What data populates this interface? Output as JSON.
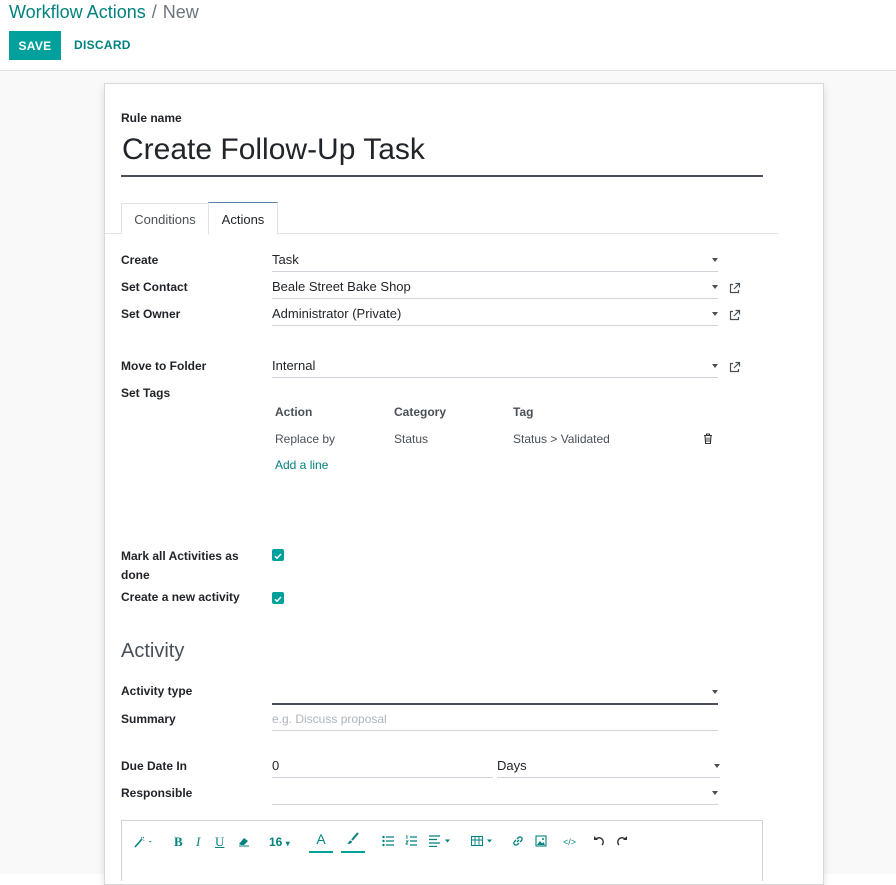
{
  "breadcrumb": {
    "parent": "Workflow Actions",
    "separator": "/",
    "current": "New"
  },
  "buttons": {
    "save": "SAVE",
    "discard": "DISCARD"
  },
  "form": {
    "rule_name_label": "Rule name",
    "rule_name": "Create Follow-Up Task",
    "tabs": [
      {
        "label": "Conditions",
        "active": false
      },
      {
        "label": "Actions",
        "active": true
      }
    ],
    "create": {
      "label": "Create",
      "value": "Task"
    },
    "set_contact": {
      "label": "Set Contact",
      "value": "Beale Street Bake Shop"
    },
    "set_owner": {
      "label": "Set Owner",
      "value": "Administrator (Private)"
    },
    "move_to_folder": {
      "label": "Move to Folder",
      "value": "Internal"
    },
    "set_tags": {
      "label": "Set Tags",
      "columns": [
        "Action",
        "Category",
        "Tag"
      ],
      "rows": [
        {
          "action": "Replace by",
          "category": "Status",
          "tag": "Status > Validated"
        }
      ],
      "add_line": "Add a line"
    },
    "mark_done": {
      "label_line1": "Mark all Activities as",
      "label_line2": "done",
      "checked": true
    },
    "create_activity": {
      "label": "Create a new activity",
      "checked": true
    },
    "activity_section": "Activity",
    "activity_type": {
      "label": "Activity type",
      "value": ""
    },
    "summary": {
      "label": "Summary",
      "placeholder": "e.g. Discuss proposal"
    },
    "due_date": {
      "label": "Due Date In",
      "value": "0",
      "unit": "Days"
    },
    "responsible": {
      "label": "Responsible",
      "value": ""
    }
  },
  "editor_toolbar": {
    "font_size": "16"
  },
  "colors": {
    "brand": "#00a09d",
    "link": "#00827f"
  }
}
